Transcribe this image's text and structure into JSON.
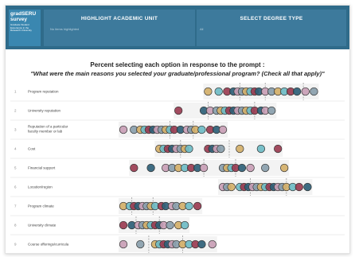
{
  "header": {
    "logo": {
      "title_line1": "gradSERU",
      "title_line2": "survey",
      "subtitle": "Graduate Student Experience in the Research University"
    },
    "highlight_panel": {
      "title": "HIGHLIGHT ACADEMIC UNIT",
      "value": "No items highlighted"
    },
    "degree_panel": {
      "title": "SELECT DEGREE TYPE",
      "value": "All"
    }
  },
  "chart_data": {
    "type": "scatter",
    "title": "Percent selecting each option in response to the prompt :",
    "subtitle": "\"What were the main reasons you selected your graduate/professional program? (Check all that apply)\"",
    "palette": [
      "#d4b06a",
      "#6fbcc6",
      "#9b3d52",
      "#2f6178",
      "#c99fb6",
      "#8aa0ad"
    ],
    "rows": [
      {
        "num": "1",
        "label": "Program reputation",
        "medians": [
          0.55,
          0.67,
          0.85
        ],
        "dots": [
          0.4,
          0.45,
          0.49,
          0.52,
          0.54,
          0.56,
          0.58,
          0.6,
          0.62,
          0.64,
          0.67,
          0.7,
          0.73,
          0.76,
          0.79,
          0.82,
          0.86,
          0.9
        ]
      },
      {
        "num": "2",
        "label": "University reputation",
        "medians": [
          0.4,
          0.62
        ],
        "dots": [
          0.26,
          0.38,
          0.41,
          0.44,
          0.46,
          0.48,
          0.5,
          0.52,
          0.54,
          0.56,
          0.58,
          0.6,
          0.62,
          0.65,
          0.67,
          0.7
        ]
      },
      {
        "num": "3",
        "label": "Reputation of a particular faculty member or lab",
        "medians": [
          0.22,
          0.33
        ],
        "dots": [
          0.0,
          0.05,
          0.08,
          0.1,
          0.12,
          0.14,
          0.16,
          0.18,
          0.2,
          0.22,
          0.24,
          0.27,
          0.3,
          0.32,
          0.34,
          0.37,
          0.41,
          0.44,
          0.47
        ]
      },
      {
        "num": "4",
        "label": "Cost",
        "medians": [
          0.27,
          0.5
        ],
        "dots": [
          0.17,
          0.19,
          0.21,
          0.23,
          0.25,
          0.27,
          0.29,
          0.31,
          0.4,
          0.42,
          0.44,
          0.46,
          0.55,
          0.65,
          0.73
        ]
      },
      {
        "num": "5",
        "label": "Financial support",
        "medians": [
          0.38,
          0.53
        ],
        "dots": [
          0.05,
          0.13,
          0.2,
          0.23,
          0.26,
          0.29,
          0.32,
          0.35,
          0.38,
          0.47,
          0.49,
          0.51,
          0.53,
          0.56,
          0.6,
          0.67,
          0.76
        ]
      },
      {
        "num": "6",
        "label": "Location/region",
        "medians": [
          0.6,
          0.77
        ],
        "dots": [
          0.47,
          0.49,
          0.51,
          0.55,
          0.57,
          0.59,
          0.61,
          0.63,
          0.65,
          0.67,
          0.69,
          0.71,
          0.73,
          0.75,
          0.77,
          0.8,
          0.83,
          0.87
        ]
      },
      {
        "num": "7",
        "label": "Program climate",
        "medians": [
          0.04,
          0.14
        ],
        "dots": [
          0.0,
          0.03,
          0.05,
          0.07,
          0.09,
          0.11,
          0.13,
          0.15,
          0.18,
          0.2,
          0.23,
          0.25,
          0.28,
          0.31,
          0.35
        ]
      },
      {
        "num": "8",
        "label": "University climate",
        "medians": [
          0.06,
          0.17
        ],
        "dots": [
          0.0,
          0.04,
          0.07,
          0.09,
          0.11,
          0.13,
          0.15,
          0.17,
          0.19,
          0.22,
          0.26,
          0.29
        ]
      },
      {
        "num": "9",
        "label": "Course offerings/curricula",
        "medians": [
          0.12,
          0.28
        ],
        "dots": [
          0.0,
          0.08,
          0.15,
          0.17,
          0.19,
          0.21,
          0.23,
          0.25,
          0.28,
          0.31,
          0.34,
          0.37,
          0.42
        ]
      }
    ]
  }
}
